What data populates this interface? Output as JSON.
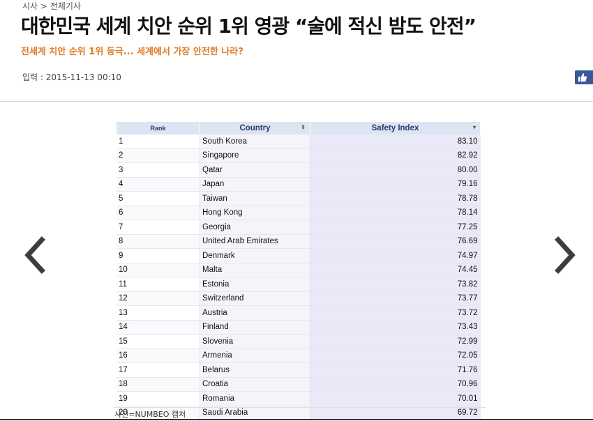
{
  "breadcrumb": {
    "section": "시사",
    "separator": ">",
    "subsection": "전체기사"
  },
  "article": {
    "headline": "대한민국 세계 치안 순위 1위 영광 “술에 적신 밤도 안전”",
    "subtitle": "전세계 치안 순위 1위 등극... 세계에서 가장 안전한 나라?",
    "dateline": "입력 : 2015-11-13 00:10",
    "photo_caption": "사진=NUMBEO 캡처"
  },
  "table": {
    "headers": {
      "rank": "Rank",
      "country": "Country",
      "index": "Safety Index"
    },
    "sort_icons": {
      "country": "⇕",
      "index": "▾"
    },
    "rows": [
      {
        "rank": "1",
        "country": "South Korea",
        "index": "83.10"
      },
      {
        "rank": "2",
        "country": "Singapore",
        "index": "82.92"
      },
      {
        "rank": "3",
        "country": "Qatar",
        "index": "80.00"
      },
      {
        "rank": "4",
        "country": "Japan",
        "index": "79.16"
      },
      {
        "rank": "5",
        "country": "Taiwan",
        "index": "78.78"
      },
      {
        "rank": "6",
        "country": "Hong Kong",
        "index": "78.14"
      },
      {
        "rank": "7",
        "country": "Georgia",
        "index": "77.25"
      },
      {
        "rank": "8",
        "country": "United Arab Emirates",
        "index": "76.69"
      },
      {
        "rank": "9",
        "country": "Denmark",
        "index": "74.97"
      },
      {
        "rank": "10",
        "country": "Malta",
        "index": "74.45"
      },
      {
        "rank": "11",
        "country": "Estonia",
        "index": "73.82"
      },
      {
        "rank": "12",
        "country": "Switzerland",
        "index": "73.77"
      },
      {
        "rank": "13",
        "country": "Austria",
        "index": "73.72"
      },
      {
        "rank": "14",
        "country": "Finland",
        "index": "73.43"
      },
      {
        "rank": "15",
        "country": "Slovenia",
        "index": "72.99"
      },
      {
        "rank": "16",
        "country": "Armenia",
        "index": "72.05"
      },
      {
        "rank": "17",
        "country": "Belarus",
        "index": "71.76"
      },
      {
        "rank": "18",
        "country": "Croatia",
        "index": "70.96"
      },
      {
        "rank": "19",
        "country": "Romania",
        "index": "70.01"
      },
      {
        "rank": "20",
        "country": "Saudi Arabia",
        "index": "69.72"
      }
    ]
  },
  "icons": {
    "prev": "chevron-left-icon",
    "next": "chevron-right-icon",
    "like": "thumbs-up-icon"
  },
  "colors": {
    "subtitle": "#e07a24",
    "facebook": "#3b5998",
    "table_header": "#dde5f3",
    "index_column": "#e9e9f8"
  }
}
